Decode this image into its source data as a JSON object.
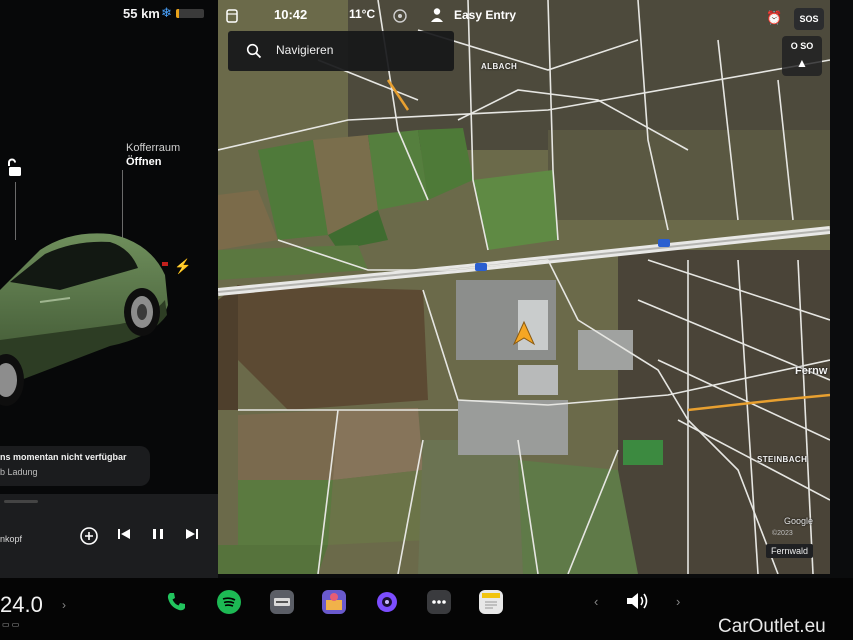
{
  "vehicle": {
    "range": "55 km",
    "battery_level": 0.12,
    "trunk_title": "Kofferraum",
    "trunk_action": "Öffnen",
    "paint_color": "#5b7a4a"
  },
  "notification": {
    "line1": "ns momentan nicht verfügbar",
    "line2": "b Ladung"
  },
  "media": {
    "source_label": "nkopf",
    "controls": [
      "add-icon",
      "skip-back-icon",
      "pause-icon",
      "skip-forward-icon"
    ]
  },
  "status_bar": {
    "time": "10:42",
    "temperature": "11°C",
    "profile": "Easy Entry",
    "sos": "SOS",
    "compass": "O SO"
  },
  "search": {
    "placeholder": "Navigieren"
  },
  "map": {
    "labels": {
      "albach": "ALBACH",
      "fern": "Fernw",
      "steinbach": "STEINBACH"
    },
    "location_chip": "Fernwald",
    "provider": "Google",
    "copyright": "©2023",
    "highway_marker": "5",
    "nav_arrow_color": "#f5a623"
  },
  "dock": {
    "cabin_temp": "24.0",
    "apps": [
      "phone-icon",
      "spotify-icon",
      "dashcam-icon",
      "toybox-icon",
      "camera-icon",
      "more-icon",
      "notes-icon"
    ],
    "volume_icon": "speaker-icon"
  },
  "watermark": "CarOutlet.eu"
}
